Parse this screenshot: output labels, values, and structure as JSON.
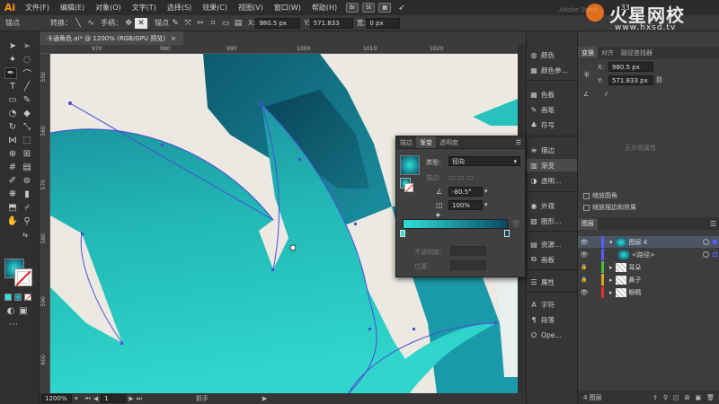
{
  "app": {
    "logo": "Ai"
  },
  "menu": {
    "items": [
      "文件(F)",
      "编辑(E)",
      "对象(O)",
      "文字(T)",
      "选择(S)",
      "效果(C)",
      "视图(V)",
      "窗口(W)",
      "帮助(H)"
    ],
    "br_label": "Br",
    "st_label": "St",
    "zoom_num": "33"
  },
  "control": {
    "anchor_label": "锚点",
    "convert_label": "转换：",
    "handle_label": "手柄：",
    "anchors_label": "锚点",
    "x_label": "X:",
    "x_value": "980.5 px",
    "y_label": "Y:",
    "y_value": "571.833",
    "w_label": "宽:",
    "w_value": "0 px"
  },
  "document": {
    "tab_title": "卡通角色.ai* @ 1200% (RGB/GPU 预览)",
    "close": "×"
  },
  "ruler": {
    "top": [
      "970",
      "980",
      "990",
      "1000",
      "1010",
      "1020"
    ],
    "left": [
      "550",
      "560",
      "570",
      "580",
      "590",
      "600"
    ]
  },
  "status": {
    "zoom": "1200%",
    "page": "1",
    "tool": "抓手"
  },
  "dock": {
    "items": [
      "颜色",
      "颜色参…",
      "色板",
      "画笔",
      "符号",
      "描边",
      "渐变",
      "透明…",
      "外观",
      "图形…",
      "资源…",
      "画板",
      "属性",
      "字符",
      "段落",
      "Ope…"
    ]
  },
  "right_panel": {
    "tabs": [
      "变换",
      "对齐",
      "路径查找器"
    ],
    "x_label": "X:",
    "x_value": "980.5 px",
    "y_label": "Y:",
    "y_value": "571.833 px",
    "no_state": "无外观属性",
    "scale_corners": "缩放圆角",
    "scale_strokes": "缩放描边和效果",
    "layers_tab": "图层",
    "layers": [
      {
        "name": "图层 4",
        "level": 0
      },
      {
        "name": "<路径>",
        "level": 1
      },
      {
        "name": "耳朵",
        "level": 0
      },
      {
        "name": "鼻子",
        "level": 0
      },
      {
        "name": "眼睛",
        "level": 0
      }
    ],
    "layer_count": "4 图层"
  },
  "gradient_panel": {
    "tabs": [
      "描边",
      "渐变",
      "透明度"
    ],
    "type_label": "类型:",
    "type_value": "径向",
    "stroke_label": "描边:",
    "angle_value": "-80.5°",
    "ratio_value": "100%",
    "opacity_label": "不透明度:",
    "position_label": "位置:",
    "colors": {
      "start": "#2ee0d8",
      "end": "#0b4a66"
    }
  },
  "watermark": {
    "brand": "火星网校",
    "url": "www.hxsd.tv",
    "faint": "Adobe Stock"
  },
  "colors": {
    "teal_light": "#2fd5cc",
    "teal_dark": "#0c5a72",
    "path_blue": "#4b4bd8",
    "canvas_bg": "#ece9e2"
  }
}
